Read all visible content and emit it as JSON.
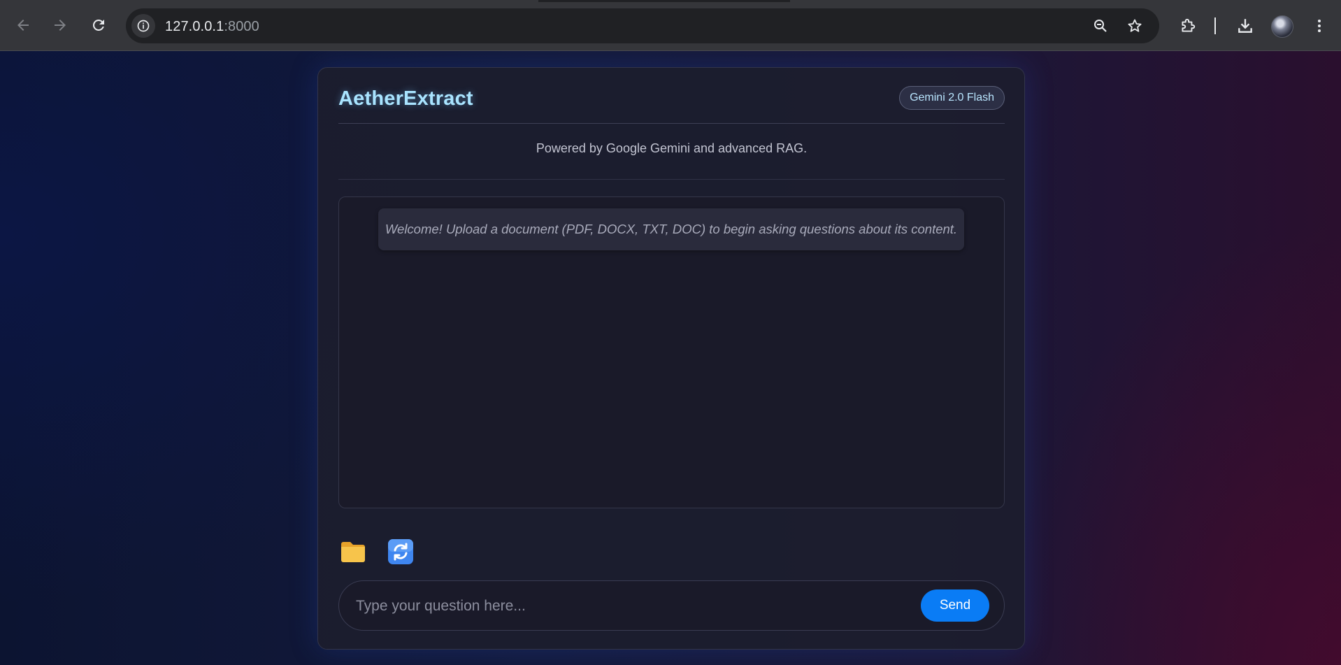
{
  "browser": {
    "url_host": "127.0.0.1",
    "url_port": ":8000",
    "icons": [
      "back-arrow-icon",
      "forward-arrow-icon",
      "reload-icon",
      "site-info-icon",
      "zoom-icon",
      "bookmark-star-icon",
      "extensions-icon",
      "download-icon",
      "profile-avatar",
      "more-menu-icon"
    ]
  },
  "app": {
    "title": "AetherExtract",
    "model_badge": "Gemini 2.0 Flash",
    "tagline": "Powered by Google Gemini and advanced RAG.",
    "welcome_message": "Welcome! Upload a document (PDF, DOCX, TXT, DOC) to begin asking questions about its content.",
    "tools": [
      "folder-icon",
      "refresh-icon"
    ],
    "input_placeholder": "Type your question here...",
    "send_label": "Send",
    "colors": {
      "brand": "#a9e4ff",
      "send_button": "#0a7cf5",
      "folder": "#f5b63a",
      "refresh": "#3f86f0"
    }
  }
}
